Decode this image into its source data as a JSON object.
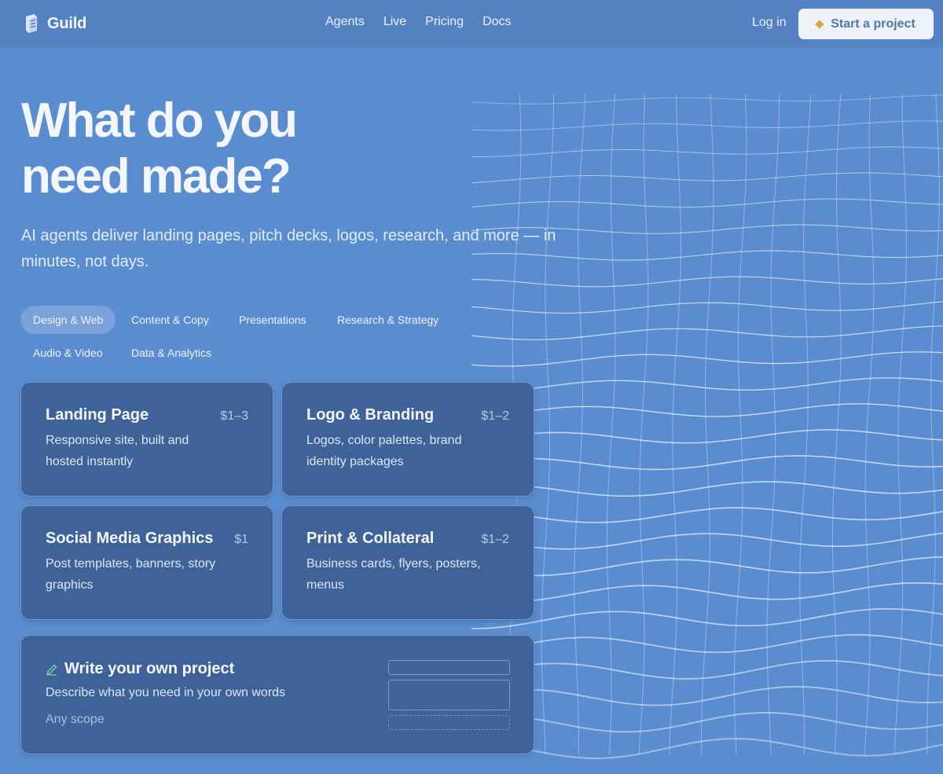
{
  "brand": {
    "name": "Guild"
  },
  "nav": {
    "items": [
      "Agents",
      "Live",
      "Pricing",
      "Docs"
    ],
    "login": "Log in",
    "cta": "Start a project"
  },
  "hero": {
    "title_line1": "What do you",
    "title_line2": "need made?",
    "subtitle": "AI agents deliver landing pages, pitch decks, logos, research, and more — in minutes, not days."
  },
  "categories": {
    "active": "Design & Web",
    "items": [
      "Design & Web",
      "Content & Copy",
      "Presentations",
      "Research & Strategy",
      "Audio & Video",
      "Data & Analytics"
    ]
  },
  "services": [
    {
      "title": "Landing Page",
      "price": "$1–3",
      "description": "Responsive site, built and hosted instantly"
    },
    {
      "title": "Logo & Branding",
      "price": "$1–2",
      "description": "Logos, color palettes, brand identity packages"
    },
    {
      "title": "Social Media Graphics",
      "price": "$1",
      "description": "Post templates, banners, story graphics"
    },
    {
      "title": "Print & Collateral",
      "price": "$1–2",
      "description": "Business cards, flyers, posters, menus"
    }
  ],
  "custom": {
    "title": "Write your own project",
    "description": "Describe what you need in your own words",
    "scope": "Any scope"
  },
  "icons": {
    "brand": "guild-logo-icon",
    "cta": "diamond-icon",
    "custom": "pencil-icon"
  },
  "colors": {
    "background": "#5a8dd0",
    "header": "#5381c2",
    "card": "#3f6399",
    "cta_bg": "#eef2f8",
    "cta_text": "#4c77b0",
    "accent": "#e0a443"
  }
}
